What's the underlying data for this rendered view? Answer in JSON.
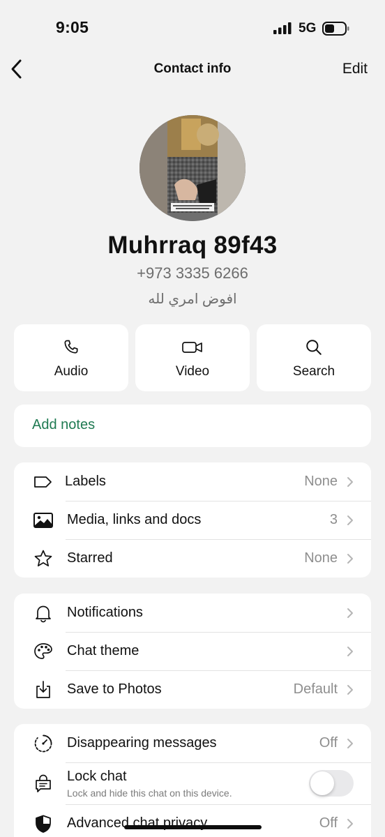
{
  "status_bar": {
    "time": "9:05",
    "network": "5G"
  },
  "nav": {
    "title": "Contact info",
    "edit_label": "Edit"
  },
  "contact": {
    "name": "Muhrraq 89f43",
    "phone": "+973 3335 6266",
    "about": "افوض امري لله"
  },
  "actions": [
    {
      "label": "Audio",
      "icon": "phone-icon"
    },
    {
      "label": "Video",
      "icon": "video-camera-icon"
    },
    {
      "label": "Search",
      "icon": "search-icon"
    }
  ],
  "notes": {
    "label": "Add notes"
  },
  "group1": [
    {
      "label": "Labels",
      "value": "None",
      "icon": "label-tag-icon"
    },
    {
      "label": "Media, links and docs",
      "value": "3",
      "icon": "media-image-icon"
    },
    {
      "label": "Starred",
      "value": "None",
      "icon": "star-icon"
    }
  ],
  "group2": [
    {
      "label": "Notifications",
      "value": "",
      "icon": "bell-icon"
    },
    {
      "label": "Chat theme",
      "value": "",
      "icon": "palette-icon"
    },
    {
      "label": "Save to Photos",
      "value": "Default",
      "icon": "save-download-icon"
    }
  ],
  "group3": {
    "disappearing": {
      "label": "Disappearing messages",
      "value": "Off",
      "icon": "timer-icon"
    },
    "lock": {
      "label": "Lock chat",
      "sublabel": "Lock and hide this chat on this device.",
      "enabled": false,
      "icon": "lock-chat-icon"
    },
    "privacy": {
      "label": "Advanced chat privacy",
      "value": "Off",
      "icon": "shield-icon"
    }
  },
  "colors": {
    "accent": "#1f7a52",
    "background": "#f2f2f2",
    "card": "#ffffff"
  }
}
